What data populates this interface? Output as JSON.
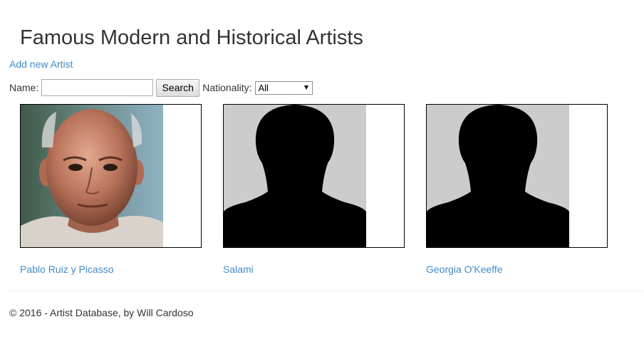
{
  "header": {
    "title": "Famous Modern and Historical Artists",
    "add_link": "Add new Artist"
  },
  "search": {
    "name_label": "Name:",
    "name_value": "",
    "search_button": "Search",
    "nationality_label": "Nationality:",
    "nationality_selected": "All"
  },
  "artists": [
    {
      "name": "Pablo Ruiz y Picasso",
      "photo": "portrait-photo"
    },
    {
      "name": "Salami",
      "photo": "silhouette-placeholder"
    },
    {
      "name": "Georgia O'Keeffe",
      "photo": "silhouette-placeholder"
    }
  ],
  "footer": {
    "text": "© 2016 - Artist Database, by Will Cardoso"
  },
  "colors": {
    "link": "#428bca",
    "text": "#333333",
    "placeholder_bg": "#cccccc"
  }
}
